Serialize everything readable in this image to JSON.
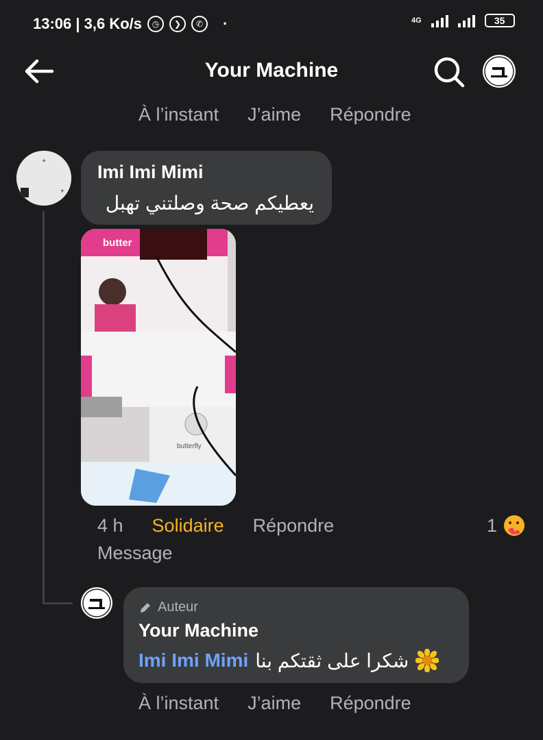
{
  "status_bar": {
    "time_speed": "13:06 | 3,6 Ko/s",
    "network": "4G",
    "battery": "35"
  },
  "header": {
    "title": "Your Machine"
  },
  "top_actions": {
    "time": "À l’instant",
    "like": "J’aime",
    "reply": "Répondre"
  },
  "comment": {
    "author": "Imi Imi Mimi",
    "text": "يعطيكم صحة وصلتني تهبل",
    "image_brand": "butter",
    "image_brand2": "butterfly",
    "time": "4 h",
    "reaction_label": "Solidaire",
    "reply": "Répondre",
    "message": "Message",
    "reaction_count": "1"
  },
  "reply": {
    "badge": "Auteur",
    "author": "Your Machine",
    "mention": "Imi Imi Mimi",
    "text": "شكرا على ثقتكم بنا",
    "time": "À l’instant",
    "like": "J’aime",
    "reply": "Répondre"
  },
  "colors": {
    "background": "#1c1c1e",
    "bubble": "#3a3b3c",
    "reaction_orange": "#f7b125",
    "mention_blue": "#6ea2ff"
  }
}
